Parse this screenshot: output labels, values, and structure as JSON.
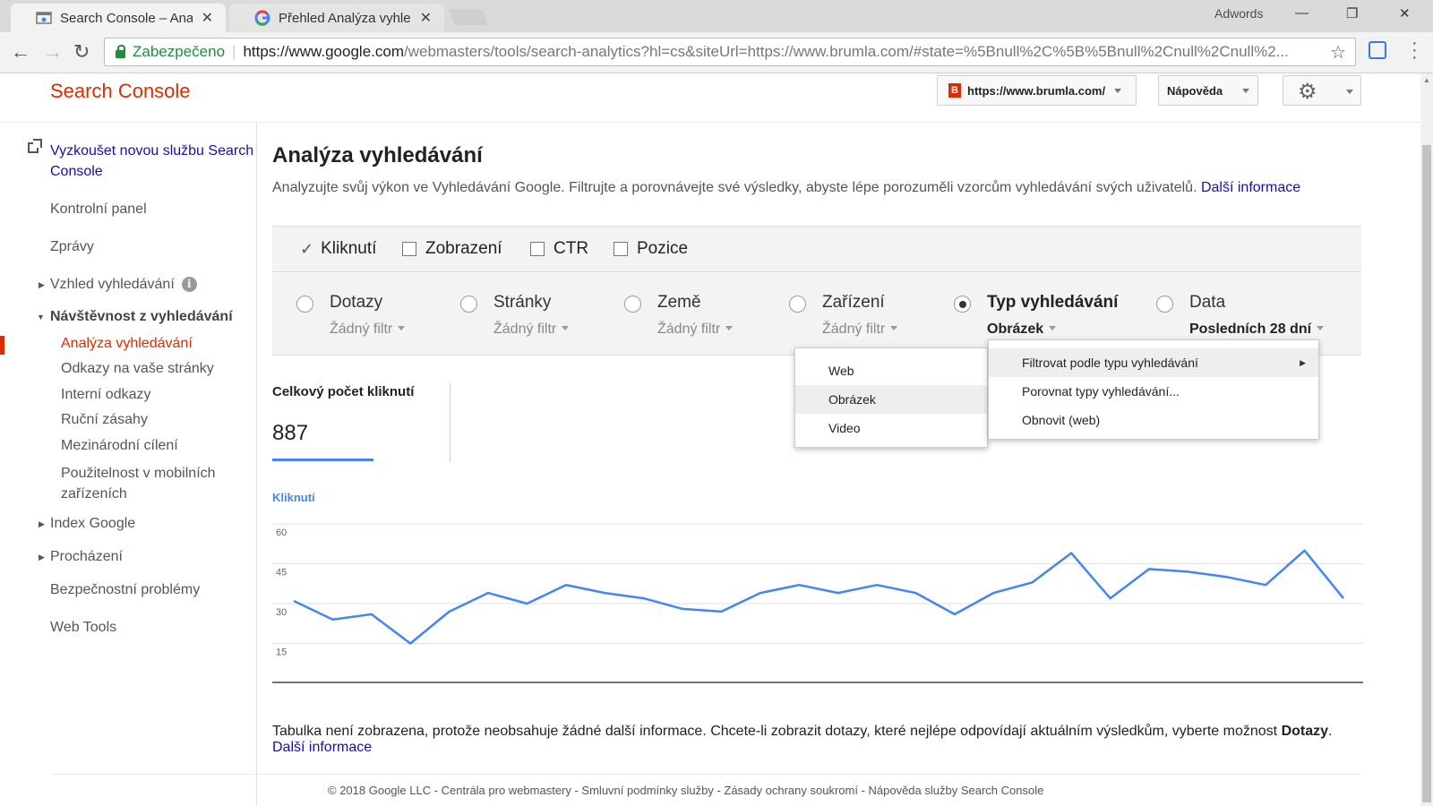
{
  "browser": {
    "tabs": [
      {
        "title": "Search Console – Analýz",
        "active": true
      },
      {
        "title": "Přehled Analýza vyhledáv",
        "active": false
      }
    ],
    "profile_label": "Adwords",
    "secure_label": "Zabezpečeno",
    "url_host": "https://www.google.com",
    "url_rest": "/webmasters/tools/search-analytics?hl=cs&siteUrl=https://www.brumla.com/#state=%5Bnull%2C%5B%5Bnull%2Cnull%2Cnull%2..."
  },
  "header": {
    "logo": "Search Console",
    "site_select": "https://www.brumla.com/",
    "help_button": "Nápověda"
  },
  "sidebar": {
    "try_new": "Vyzkoušet novou službu Search Console",
    "items": [
      "Kontrolní panel",
      "Zprávy",
      "Vzhled vyhledávání",
      "Návštěvnost z vyhledávání",
      "Index Google",
      "Procházení",
      "Bezpečnostní problémy",
      "Web Tools"
    ],
    "subitems": [
      "Analýza vyhledávání",
      "Odkazy na vaše stránky",
      "Interní odkazy",
      "Ruční zásahy",
      "Mezinárodní cílení",
      "Použitelnost v mobilních zařízeních"
    ]
  },
  "main": {
    "title": "Analýza vyhledávání",
    "description": "Analyzujte svůj výkon ve Vyhledávání Google. Filtrujte a porovnávejte své výsledky, abyste lépe porozuměli vzorcům vyhledávání svých uživatelů.",
    "more_info": "Další informace",
    "metrics": [
      {
        "label": "Kliknutí",
        "checked": true
      },
      {
        "label": "Zobrazení",
        "checked": false
      },
      {
        "label": "CTR",
        "checked": false
      },
      {
        "label": "Pozice",
        "checked": false
      }
    ],
    "groups": [
      {
        "label": "Dotazy",
        "filter": "Žádný filtr",
        "selected": false
      },
      {
        "label": "Stránky",
        "filter": "Žádný filtr",
        "selected": false
      },
      {
        "label": "Země",
        "filter": "Žádný filtr",
        "selected": false
      },
      {
        "label": "Zařízení",
        "filter": "Žádný filtr",
        "selected": false
      },
      {
        "label": "Typ vyhledávání",
        "filter": "Obrázek",
        "selected": true
      },
      {
        "label": "Data",
        "filter": "Posledních 28 dní",
        "selected": false
      }
    ],
    "type_menu": [
      "Web",
      "Obrázek",
      "Video"
    ],
    "type_menu_hovered": "Obrázek",
    "filter_menu": [
      "Filtrovat podle typu vyhledávání",
      "Porovnat typy vyhledávání...",
      "Obnovit (web)"
    ],
    "total_label": "Celkový počet kliknutí",
    "total_value": "887",
    "footnote_text": "Tabulka není zobrazena, protože neobsahuje žádné další informace. Chcete-li zobrazit dotazy, které nejlépe odpovídají aktuálním výsledkům, vyberte možnost ",
    "footnote_bold": "Dotazy",
    "footnote_end": ".",
    "footnote_link": "Další informace"
  },
  "chart_data": {
    "type": "line",
    "title": "",
    "ylabel": "Kliknutí",
    "xlabel": "",
    "ylim": [
      0,
      60
    ],
    "yticks": [
      "60",
      "45",
      "30",
      "15"
    ],
    "grid": true,
    "legend": "none",
    "color": "#4285f4",
    "series": [
      {
        "values": [
          31,
          24,
          26,
          15,
          27,
          34,
          30,
          37,
          34,
          32,
          28,
          27,
          34,
          37,
          34,
          37,
          34,
          26,
          34,
          38,
          49,
          32,
          43,
          42,
          40,
          37,
          50,
          32
        ]
      }
    ]
  },
  "footer": {
    "text": "© 2018 Google LLC - Centrála pro webmastery - Smluvní podmínky služby - Zásady ochrany soukromí - Nápověda služby Search Console"
  }
}
